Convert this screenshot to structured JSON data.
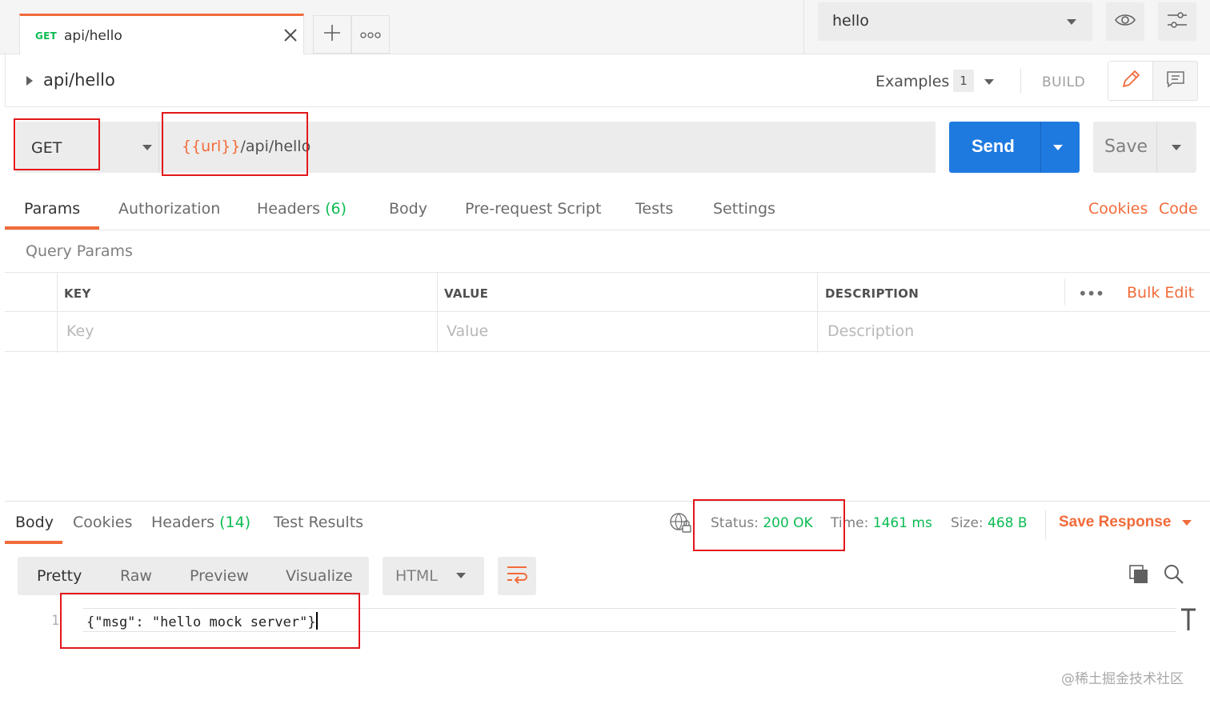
{
  "tabs": {
    "active": {
      "method": "GET",
      "title": "api/hello"
    },
    "more_icon": "more-horizontal-icon"
  },
  "environment": {
    "selected": "hello"
  },
  "request": {
    "name": "api/hello",
    "examples_label": "Examples",
    "examples_count": "1",
    "build_label": "BUILD",
    "method": "GET",
    "url_variable": "{{url}}",
    "url_path": "/api/hello",
    "send_label": "Send",
    "save_label": "Save",
    "tabs": [
      "Params",
      "Authorization",
      "Headers",
      "Body",
      "Pre-request Script",
      "Tests",
      "Settings"
    ],
    "headers_count": "(6)",
    "links": {
      "cookies": "Cookies",
      "code": "Code"
    }
  },
  "params": {
    "section_title": "Query Params",
    "columns": {
      "key": "KEY",
      "value": "VALUE",
      "description": "DESCRIPTION"
    },
    "placeholders": {
      "key": "Key",
      "value": "Value",
      "description": "Description"
    },
    "bulk_edit": "Bulk Edit",
    "more": "•••"
  },
  "response": {
    "tabs": [
      "Body",
      "Cookies",
      "Headers",
      "Test Results"
    ],
    "headers_count": "(14)",
    "status_label": "Status:",
    "status_value": "200 OK",
    "time_label": "Time:",
    "time_value": "1461 ms",
    "size_label": "Size:",
    "size_value": "468 B",
    "save_response": "Save Response",
    "views": [
      "Pretty",
      "Raw",
      "Preview",
      "Visualize"
    ],
    "format": "HTML",
    "line_number": "1",
    "body": "{\"msg\": \"hello mock server\"}"
  },
  "watermark": "@稀土掘金技术社区",
  "colors": {
    "accent": "#f26b3a",
    "send_blue": "#1f7ae0",
    "success_green": "#0cbb52",
    "highlight_red": "#e3171c"
  }
}
